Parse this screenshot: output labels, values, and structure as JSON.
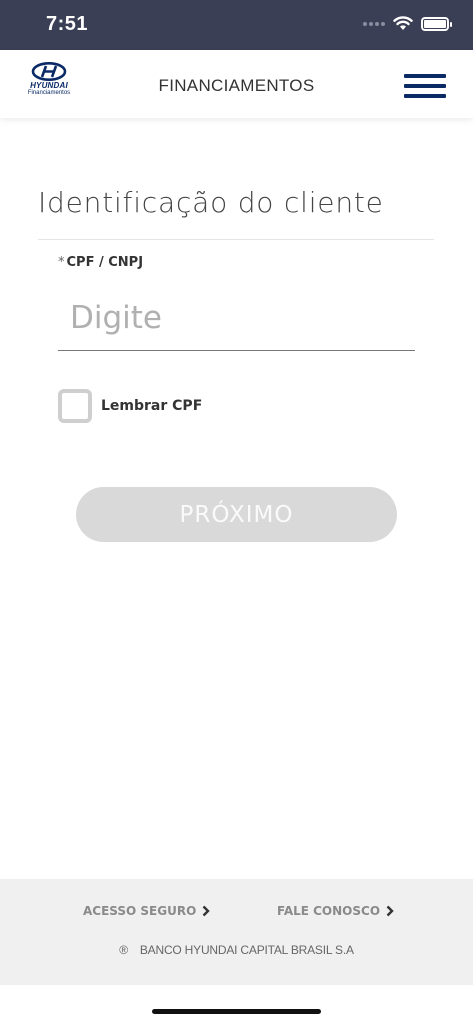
{
  "status_bar": {
    "time": "7:51"
  },
  "header": {
    "logo": {
      "brand": "HYUNDAI",
      "sub": "Financiamentos"
    },
    "title": "FINANCIAMENTOS",
    "menu_icon": "hamburger-menu-icon"
  },
  "form": {
    "title": "Identificação do cliente",
    "field_label": "CPF / CNPJ",
    "required_mark": "*",
    "input_placeholder": "Digite",
    "input_value": "",
    "remember_label": "Lembrar CPF",
    "remember_checked": false,
    "next_label": "PRÓXIMO"
  },
  "footer": {
    "link_left": "ACESSO SEGURO",
    "link_right": "FALE CONOSCO",
    "copyright_mark": "®",
    "copyright": "BANCO HYUNDAI CAPITAL BRASIL S.A"
  },
  "colors": {
    "status_bar": "#3b3f55",
    "brand_navy": "#0a2a66",
    "button_disabled": "#d9d9d9",
    "footer_bg": "#f0f0f0"
  }
}
